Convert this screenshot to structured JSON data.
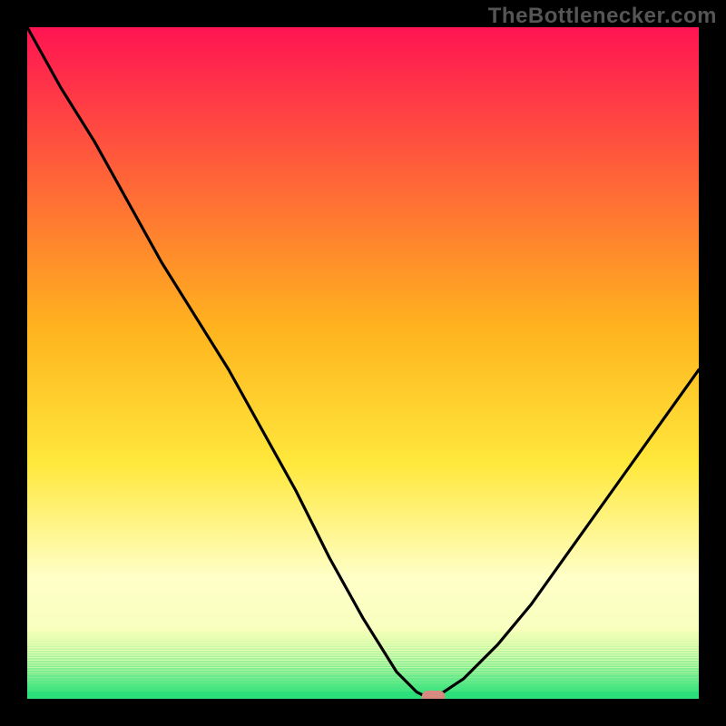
{
  "brand": "TheBottlenecker.com",
  "chart_data": {
    "type": "line",
    "title": "",
    "xlabel": "",
    "ylabel": "",
    "xlim": [
      0,
      100
    ],
    "ylim": [
      0,
      100
    ],
    "x": [
      0,
      5,
      10,
      15,
      20,
      25,
      30,
      35,
      40,
      45,
      50,
      55,
      58,
      60,
      62,
      65,
      70,
      75,
      80,
      85,
      90,
      95,
      100
    ],
    "values": [
      100,
      91,
      83,
      74,
      65,
      57,
      49,
      40,
      31,
      21,
      12,
      4,
      1,
      0,
      1,
      3,
      8,
      14,
      21,
      28,
      35,
      42,
      49
    ],
    "marker": {
      "x": 60.5,
      "y": 0
    },
    "stripes_start_y": 10,
    "dominant_stripe_color": "#2be07b",
    "gradient_stops": [
      {
        "offset": 0.0,
        "color": "#ff1452"
      },
      {
        "offset": 0.45,
        "color": "#ffb41e"
      },
      {
        "offset": 0.65,
        "color": "#ffe83c"
      },
      {
        "offset": 0.82,
        "color": "#ffffc8"
      },
      {
        "offset": 0.9,
        "color": "#f7ffbe"
      },
      {
        "offset": 1.0,
        "color": "#2be07b"
      }
    ]
  }
}
